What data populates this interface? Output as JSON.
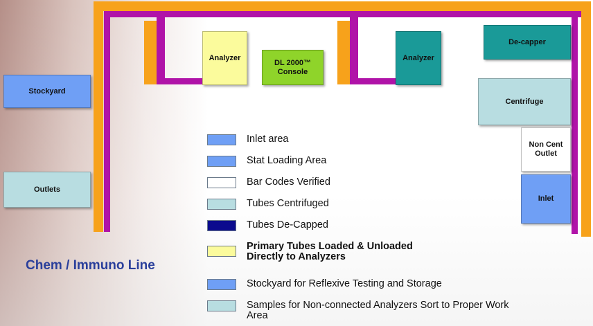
{
  "stations": {
    "stockyard": "Stockyard",
    "outlets": "Outlets",
    "analyzer_left": "Analyzer",
    "console": "DL 2000™ Console",
    "analyzer_right": "Analyzer",
    "decapper": "De-capper",
    "centrifuge": "Centrifuge",
    "noncent": "Non Cent Outlet",
    "inlet": "Inlet"
  },
  "legend": [
    {
      "label": "Inlet area",
      "color": "#6f9ff5"
    },
    {
      "label": "Stat Loading Area",
      "color": "#6f9ff5"
    },
    {
      "label": "Bar Codes Verified",
      "color": "#ffffff"
    },
    {
      "label": "Tubes Centrifuged",
      "color": "#b8dde1"
    },
    {
      "label": "Tubes De-Capped",
      "color": "#0b0b8e"
    },
    {
      "label": "Primary Tubes Loaded & Unloaded Directly to Analyzers",
      "color": "#fbfb9c"
    },
    {
      "label": "Stockyard for Reflexive Testing and Storage",
      "color": "#6f9ff5"
    },
    {
      "label": "Samples for Non-connected Analyzers Sort to Proper Work Area",
      "color": "#b8dde1"
    }
  ],
  "caption": "Chem / Immuno Line",
  "colors": {
    "track_orange": "#f7a21b",
    "track_purple": "#b013a8",
    "stockyard": "#6f9ff5",
    "outlets": "#b8dde1",
    "analyzer": "#fbfb9c",
    "console": "#8fd42a",
    "teal": "#1a9a98",
    "centrifuge": "#b8dde1",
    "inlet": "#6f9ff5"
  }
}
